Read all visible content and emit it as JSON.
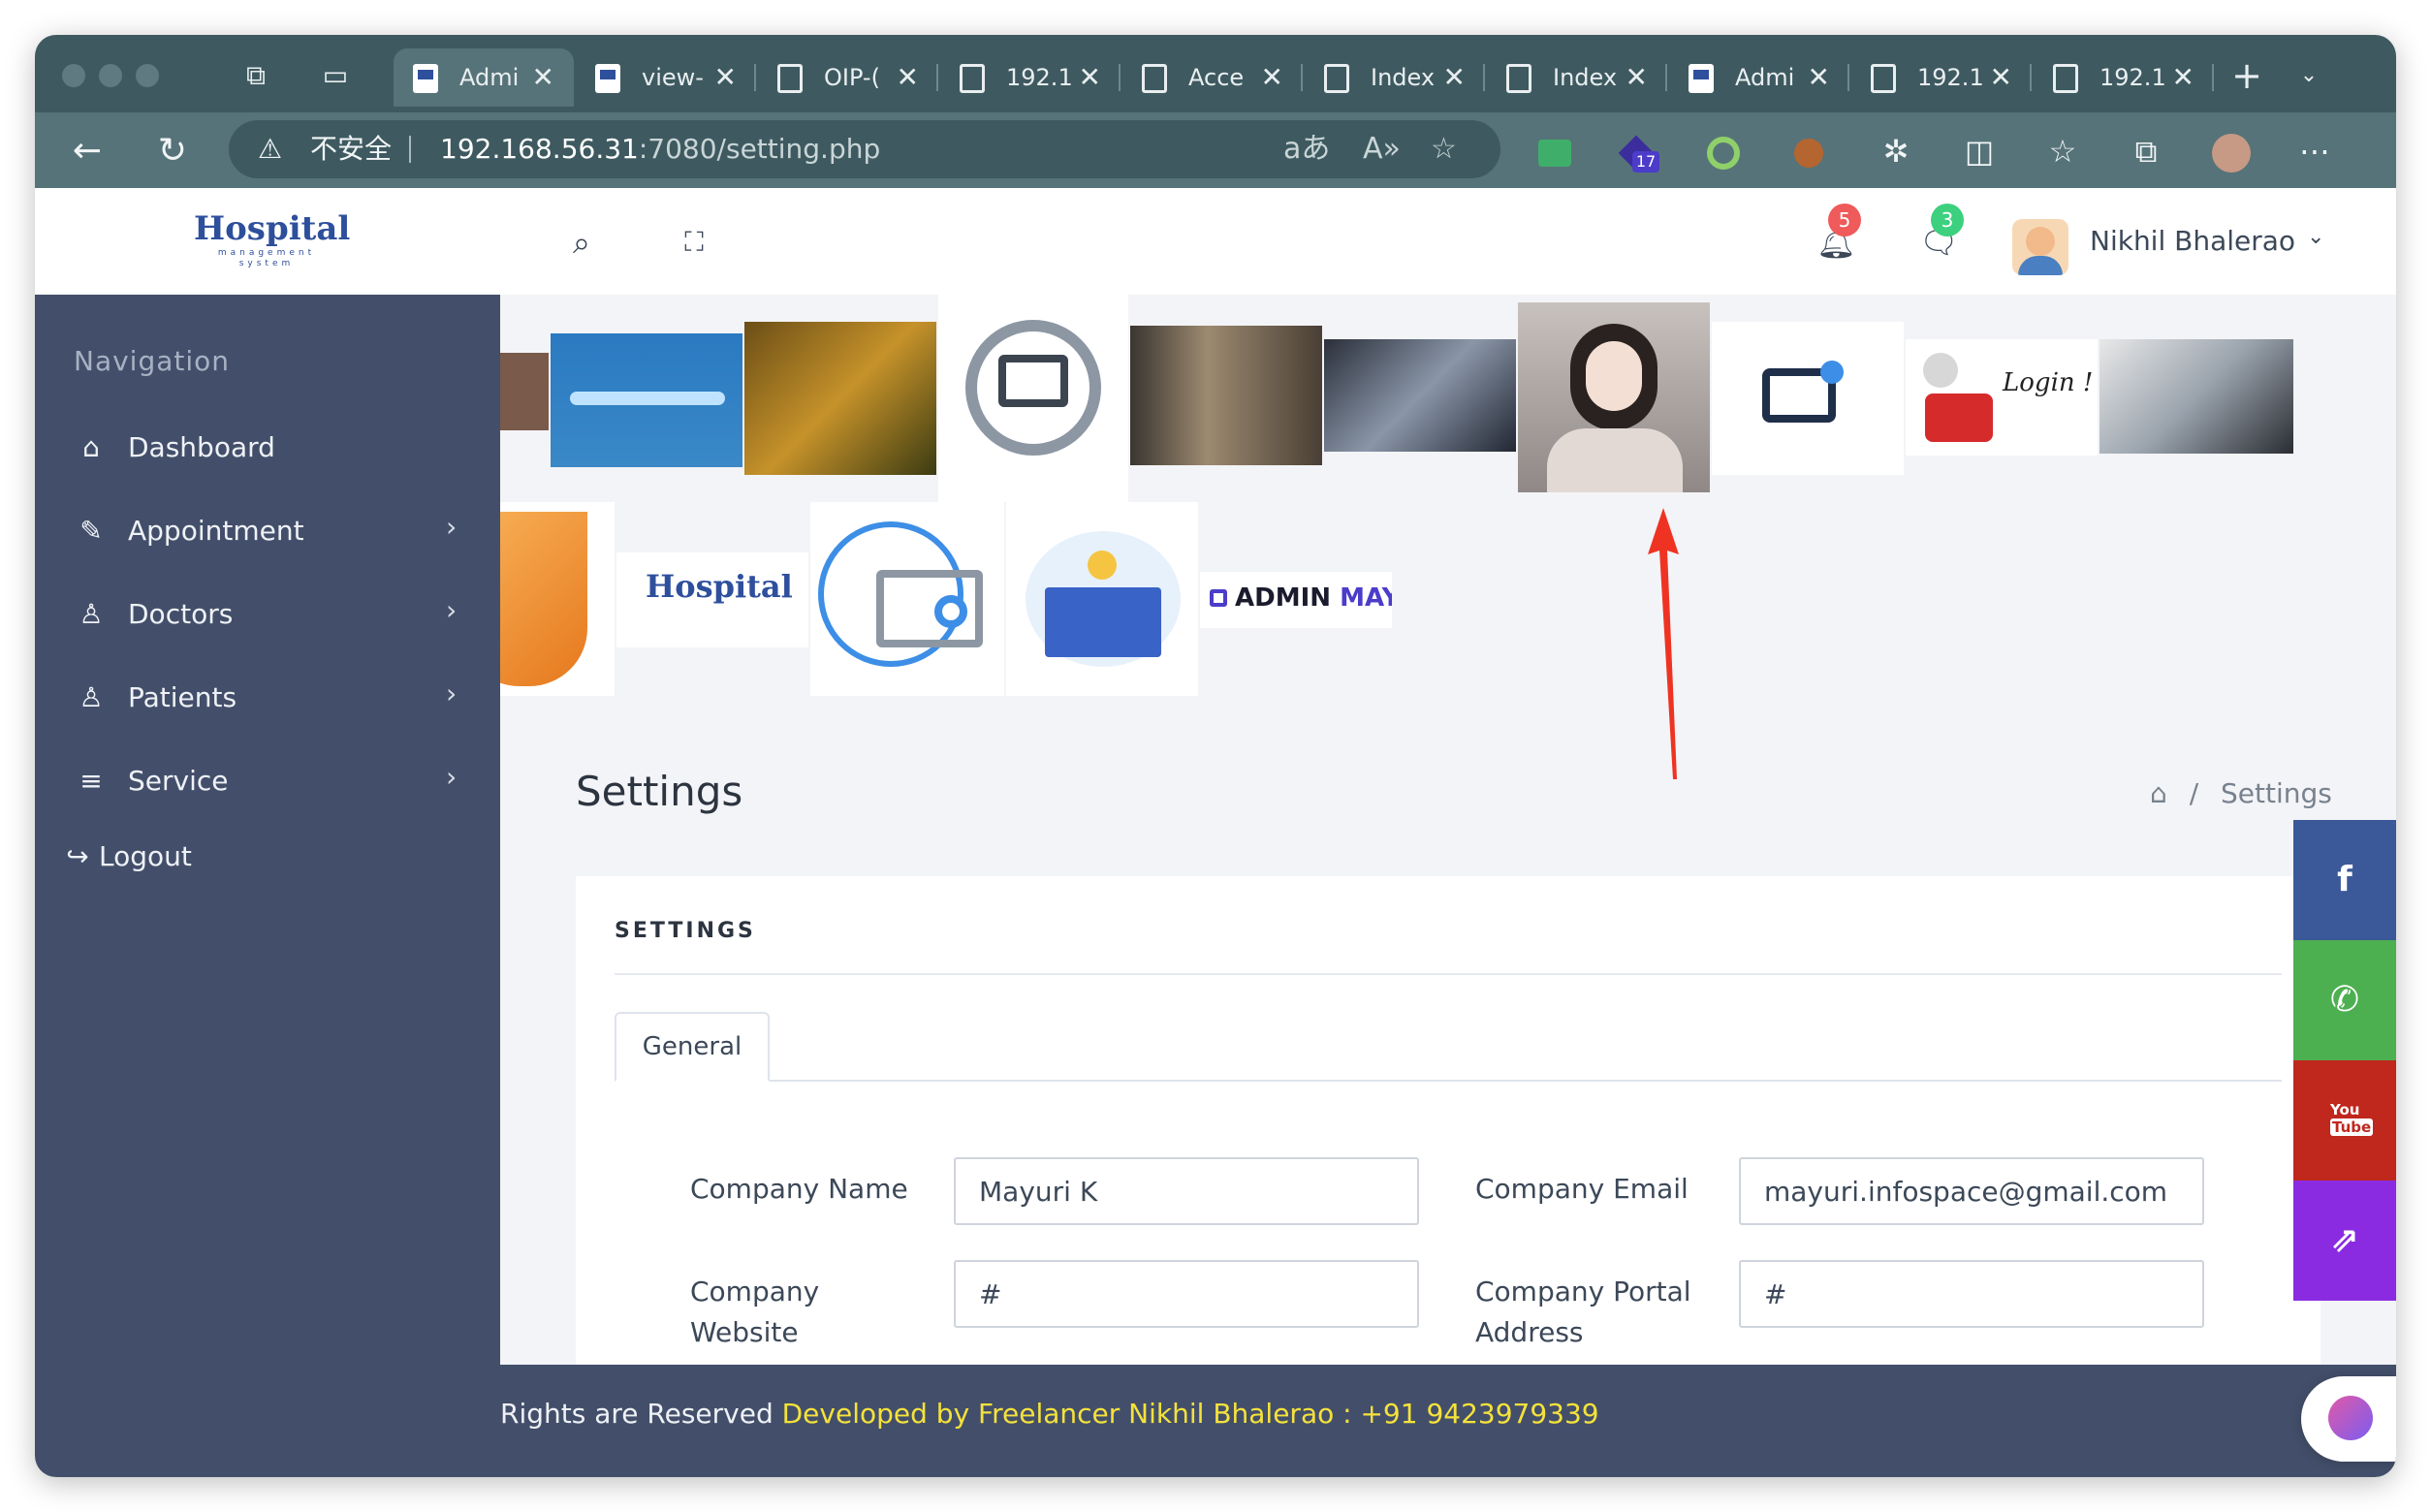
{
  "browser": {
    "tabs": [
      {
        "label": "Admi",
        "icon": "favicon",
        "active": true
      },
      {
        "label": "view-",
        "icon": "favicon",
        "active": false
      },
      {
        "label": "OIP-(",
        "icon": "page",
        "active": false
      },
      {
        "label": "192.1",
        "icon": "page",
        "active": false
      },
      {
        "label": "Acce",
        "icon": "page",
        "active": false
      },
      {
        "label": "Index",
        "icon": "page",
        "active": false
      },
      {
        "label": "Index",
        "icon": "page",
        "active": false
      },
      {
        "label": "Admi",
        "icon": "favicon",
        "active": false
      },
      {
        "label": "192.1",
        "icon": "page",
        "active": false
      },
      {
        "label": "192.1",
        "icon": "page",
        "active": false
      }
    ],
    "security_label": "不安全",
    "url_host": "192.168.56.31",
    "url_path": ":7080/setting.php",
    "extension_badge": "17"
  },
  "header": {
    "logo_text": "Hospital",
    "logo_sub": "management system",
    "notifications_count": "5",
    "messages_count": "3",
    "user_name": "Nikhil Bhalerao"
  },
  "sidebar": {
    "title": "Navigation",
    "items": [
      {
        "label": "Dashboard",
        "icon": "home-icon"
      },
      {
        "label": "Appointment",
        "icon": "edit-icon"
      },
      {
        "label": "Doctors",
        "icon": "user-icon"
      },
      {
        "label": "Patients",
        "icon": "user-icon"
      },
      {
        "label": "Service",
        "icon": "menu-icon"
      },
      {
        "label": "Logout",
        "icon": "logout-icon"
      }
    ]
  },
  "gallery": {
    "admin_logo_text_1": "ADMIN",
    "admin_logo_text_2": "MAYURI",
    "login_text": "Login !",
    "hospital_logo_text": "Hospital"
  },
  "page": {
    "title": "Settings",
    "breadcrumb_current": "Settings",
    "card_title": "SETTINGS",
    "tab_general": "General",
    "fields": {
      "company_name_label": "Company Name",
      "company_name_value": "Mayuri K",
      "company_email_label": "Company Email",
      "company_email_value": "mayuri.infospace@gmail.com",
      "company_website_label_1": "Company",
      "company_website_label_2": "Website",
      "company_website_value": "#",
      "company_portal_label_1": "Company Portal",
      "company_portal_label_2": "Address",
      "company_portal_value": "#"
    }
  },
  "footer": {
    "rights": "Rights are Reserved ",
    "developer": "Developed by Freelancer Nikhil Bhalerao : +91 9423979339"
  },
  "social": {
    "youtube_1": "You",
    "youtube_2": "Tube"
  },
  "colors": {
    "sidebar": "#434f6a",
    "facebook": "#3b5998",
    "whatsapp": "#4caf50",
    "youtube": "#c0271d",
    "share": "#8a2be2",
    "footer_highlight": "#f5e23b"
  }
}
